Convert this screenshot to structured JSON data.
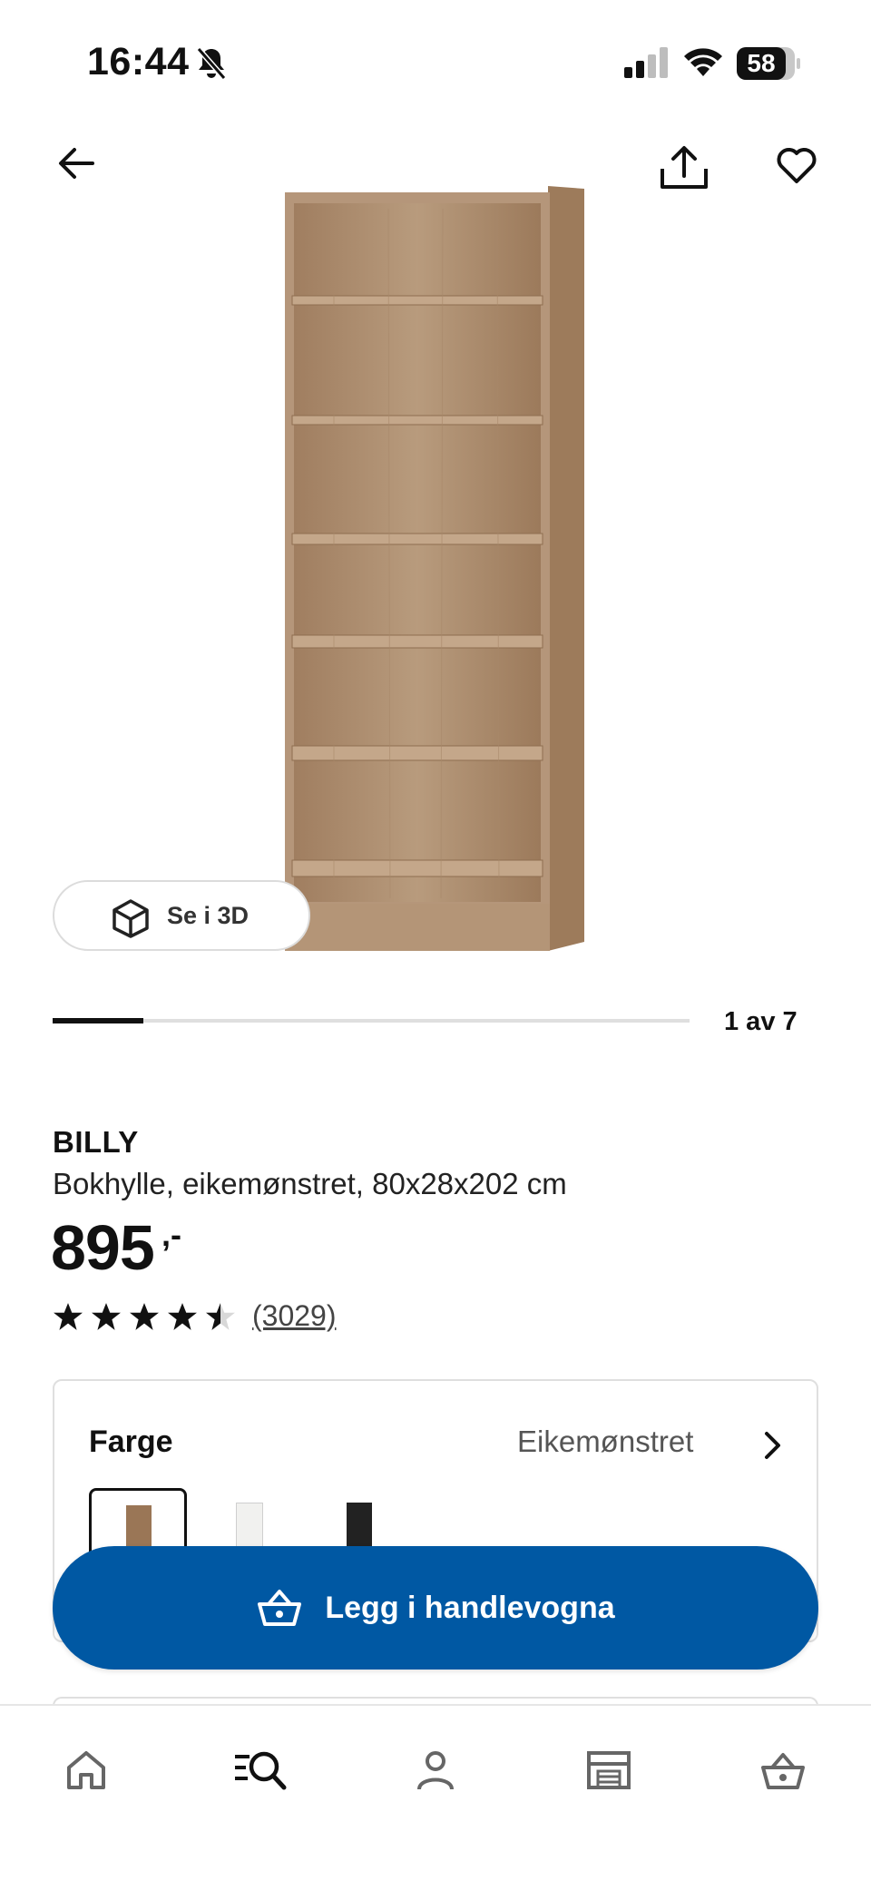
{
  "status_bar": {
    "time": "16:44",
    "battery": "58"
  },
  "gallery": {
    "view_3d_label": "Se i 3D",
    "page_indicator": "1 av 7",
    "progress_fraction": 0.1429
  },
  "product": {
    "brand": "BILLY",
    "description": "Bokhylle, eikemønstret, 80x28x202 cm",
    "price": "895",
    "price_suffix": ",-",
    "rating": 4.5,
    "review_count": "(3029)"
  },
  "color_selector": {
    "label": "Farge",
    "selected": "Eikemønstret",
    "swatches": [
      {
        "color": "#9a7656",
        "selected": true
      },
      {
        "color": "#f1f1ef",
        "selected": false
      },
      {
        "color": "#222222",
        "selected": false
      }
    ]
  },
  "cart": {
    "button_label": "Legg i handlevogna",
    "accent_color": "#0058a3"
  },
  "nav": {
    "icons": [
      "home-icon",
      "search-icon",
      "profile-icon",
      "store-icon",
      "cart-icon"
    ]
  }
}
